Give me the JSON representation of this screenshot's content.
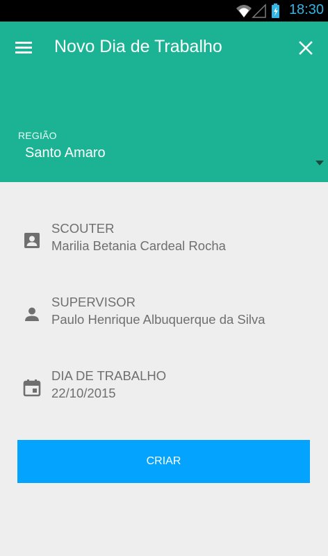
{
  "status_bar": {
    "time": "18:30",
    "icons": [
      "wifi-icon",
      "signal-icon",
      "battery-charging-icon"
    ]
  },
  "toolbar": {
    "title": "Novo Dia de Trabalho",
    "menu_icon": "hamburger-menu-icon",
    "close_icon": "close-icon"
  },
  "region": {
    "label": "REGIÃO",
    "value": "Santo Amaro"
  },
  "fields": [
    {
      "label": "SCOUTER",
      "value": "Marilia Betania Cardeal Rocha",
      "icon": "contact-card-icon"
    },
    {
      "label": "SUPERVISOR",
      "value": "Paulo Henrique Albuquerque da Silva",
      "icon": "person-icon"
    },
    {
      "label": "DIA DE TRABALHO",
      "value": "22/10/2015",
      "icon": "calendar-icon"
    }
  ],
  "actions": {
    "create_label": "CRIAR"
  },
  "colors": {
    "appbar": "#1cb394",
    "button": "#04a4fe",
    "background": "#eeeeee",
    "field_text": "#6f6f6f",
    "status_accent": "#33b5e5"
  }
}
